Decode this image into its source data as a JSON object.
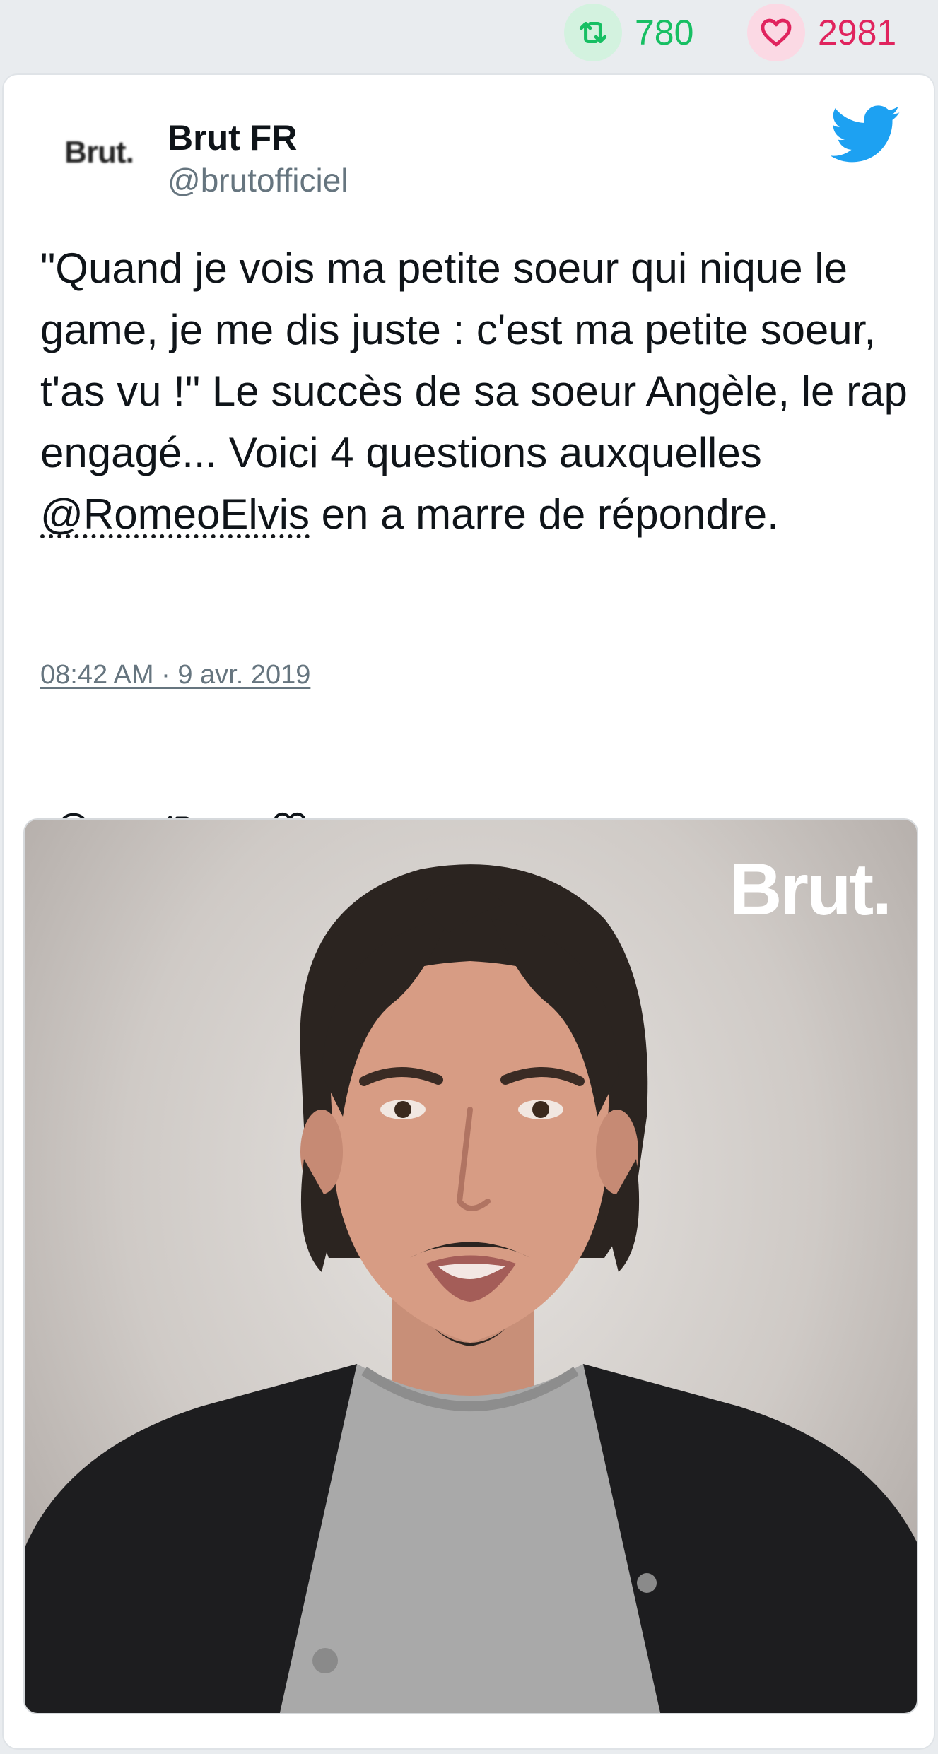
{
  "stats": {
    "retweet_count": "780",
    "like_count": "2981",
    "retweet_color": "#17bf63",
    "like_color": "#e0245e"
  },
  "tweet": {
    "avatar_label": "Brut.",
    "author_name": "Brut FR",
    "author_handle": "@brutofficiel",
    "text_before_mention": "\"Quand je vois ma petite soeur qui nique le game, je me dis juste : c'est ma petite soeur, t'as vu !\" Le succès de sa soeur Angèle, le rap engagé... Voici 4 questions auxquelles ",
    "mention": "@RomeoElvis",
    "text_after_mention": " en a marre de répondre.",
    "timestamp": "08:42 AM · 9 avr. 2019",
    "icons": {
      "brand": "twitter-bird-icon",
      "reply": "reply-icon",
      "retweet": "retweet-icon",
      "like": "heart-icon"
    },
    "brand_color": "#1da1f2"
  },
  "media": {
    "watermark": "Brut."
  }
}
